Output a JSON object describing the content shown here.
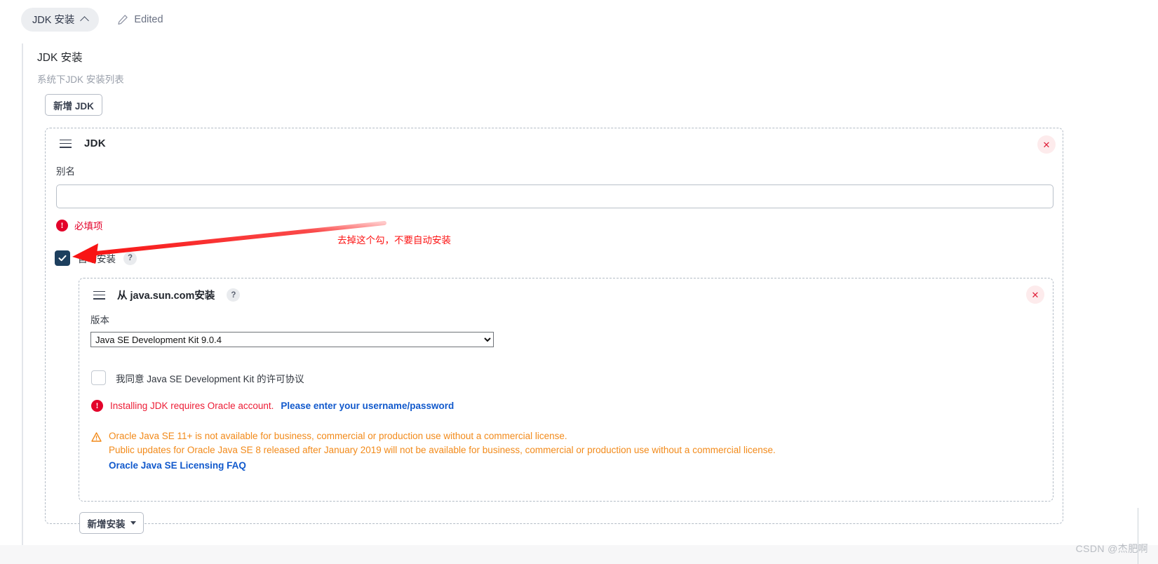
{
  "topbar": {
    "tab_label": "JDK 安装",
    "tab_caret": "chevron-up-icon",
    "edited_label": "Edited",
    "pencil_icon": "pencil-icon"
  },
  "section": {
    "title": "JDK 安装",
    "subtitle": "系统下JDK 安装列表",
    "new_jdk_button": "新增 JDK"
  },
  "jdk_card": {
    "drag_handle_icon": "hamburger-drag-icon",
    "title": "JDK",
    "close_label": "✕",
    "alias_label": "别名",
    "alias_value": "",
    "alias_placeholder": "",
    "error_icon": "!",
    "error_text": "必填项",
    "auto_install_checked": true,
    "auto_install_label": "自动安装",
    "auto_install_help": "?"
  },
  "install_panel": {
    "drag_handle_icon": "hamburger-drag-icon",
    "title": "从 java.sun.com安装",
    "help": "?",
    "close_label": "✕",
    "version_label": "版本",
    "version_selected": "Java SE Development Kit 9.0.4",
    "version_options": [
      "Java SE Development Kit 9.0.4"
    ],
    "agree_checked": false,
    "agree_label": "我同意 Java SE Development Kit 的许可协议",
    "oracle_error_icon": "!",
    "oracle_error_text": "Installing JDK requires Oracle account.",
    "oracle_error_link": "Please enter your username/password",
    "warning_icon": "warning-triangle-icon",
    "warning_line_1": "Oracle Java SE 11+ is not available for business, commercial or production use without a commercial license.",
    "warning_line_2": "Public updates for Oracle Java SE 8 released after January 2019 will not be available for business, commercial or production use without a commercial license.",
    "warning_link": "Oracle Java SE Licensing FAQ"
  },
  "footer": {
    "add_install_button": "新增安装"
  },
  "annotation": {
    "text": "去掉这个勾，不要自动安装",
    "arrow_color": "#fa2a2a"
  },
  "watermark": {
    "text": "CSDN @杰肥啊"
  },
  "colors": {
    "accent_error": "#e3022a",
    "accent_link": "#1159cc",
    "accent_warning": "#f28a1a",
    "checkbox_checked": "#1d3f5e",
    "annotation_red": "#fc1414"
  }
}
